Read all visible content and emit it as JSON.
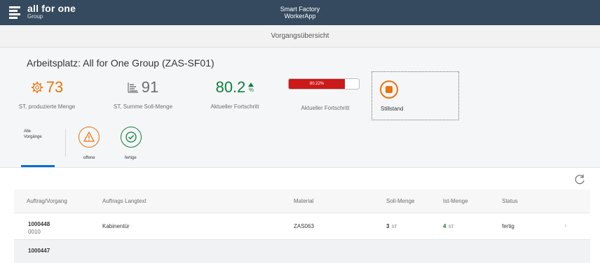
{
  "shell": {
    "brand_name": "all for one",
    "brand_sub": "Group",
    "app_title_line1": "Smart Factory",
    "app_title_line2": "WorkerApp"
  },
  "page": {
    "title": "Vorgangsübersicht"
  },
  "object_header": {
    "title": "Arbeitsplatz: All for One Group (ZAS-SF01)",
    "kpis": [
      {
        "value": "73",
        "label": "ST, produzierte Menge",
        "icon": "gear-icon"
      },
      {
        "value": "91",
        "label": "ST, Summe Soll-Menge",
        "icon": "bar-list-icon"
      },
      {
        "value": "80.2",
        "unit": "%",
        "label": "Aktueller Fortschritt",
        "trend": "up"
      },
      {
        "value_text": "80.22%",
        "fraction": 0.8022,
        "label": "Aktueller Fortschritt"
      }
    ],
    "status_tile": {
      "label": "Stillstand",
      "icon": "stop-icon"
    }
  },
  "tabs": {
    "all_line1": "Alle",
    "all_line2": "Vorgänge",
    "offen": "offene",
    "fertig": "fertige"
  },
  "table": {
    "columns": [
      "Auftrag/Vorgang",
      "Auftrags Langtext",
      "Material",
      "Soll-Menge",
      "Ist-Menge",
      "Status"
    ],
    "rows": [
      {
        "order": "1000448",
        "op": "0010",
        "text": "Kabinentür",
        "material": "ZAS063",
        "soll": "3",
        "soll_unit": "ST",
        "ist": "4",
        "ist_unit": "ST",
        "status": "fertig"
      },
      {
        "order": "1000447"
      }
    ]
  },
  "colors": {
    "shell": "#354a5f",
    "orange": "#e9730c",
    "green": "#107e3e",
    "red": "#cc1919",
    "blue": "#0a6ed1"
  }
}
